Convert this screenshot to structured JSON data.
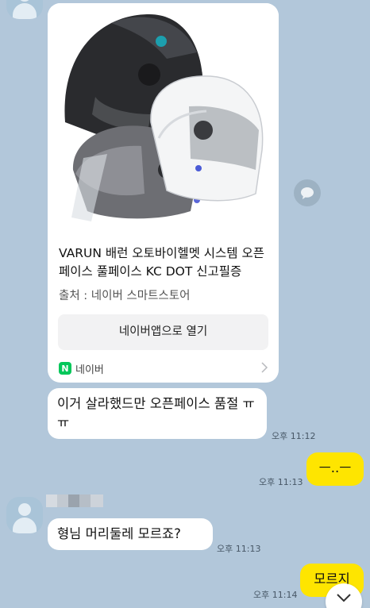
{
  "chat": {
    "link_card": {
      "title": "VARUN 배런 오토바이헬멧 시스템 오픈페이스 풀페이스 KC DOT 신고필증",
      "source": "출처 : 네이버 스마트스토어",
      "button_label": "네이버앱으로 열기",
      "footer_label": "네이버",
      "footer_logo_letter": "N",
      "image_icon": "helmet-product-photo"
    },
    "messages": [
      {
        "id": "m1",
        "direction": "in",
        "text": "이거 살라했드만 오픈페이스 품절 ㅠㅠ",
        "time": "오후 11:12"
      },
      {
        "id": "m2",
        "direction": "out",
        "text": "ㅡ..ㅡ",
        "time": "오후 11:13"
      },
      {
        "id": "m3",
        "direction": "in",
        "text": "형님 머리둘레 모르죠?",
        "time": "오후 11:13"
      },
      {
        "id": "m4",
        "direction": "out",
        "text": "모르지",
        "time": "오후 11:14"
      }
    ],
    "colors": {
      "background": "#b2c7da",
      "incoming_bubble": "#ffffff",
      "outgoing_bubble": "#fee500",
      "naver_green": "#03c75a"
    }
  }
}
